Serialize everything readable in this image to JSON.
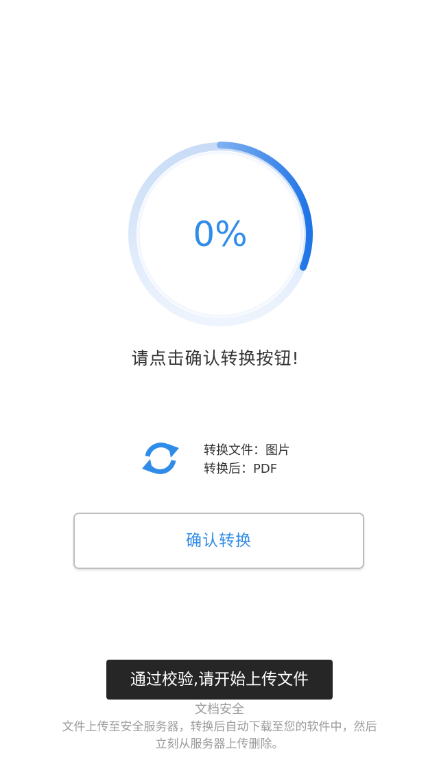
{
  "progress": {
    "percent_label": "0%",
    "fraction_shown": 0.31,
    "accent_color": "#2f8ce8"
  },
  "prompt_text": "请点击确认转换按钮!",
  "convert_info": {
    "icon": "refresh-icon",
    "source_line": "转换文件：图片",
    "target_line": "转换后：PDF"
  },
  "confirm_button_label": "确认转换",
  "toast_text": "通过校验,请开始上传文件",
  "security": {
    "title": "文档安全",
    "description": "文件上传至安全服务器，转换后自动下载至您的软件中，然后立刻从服务器上传删除。"
  }
}
